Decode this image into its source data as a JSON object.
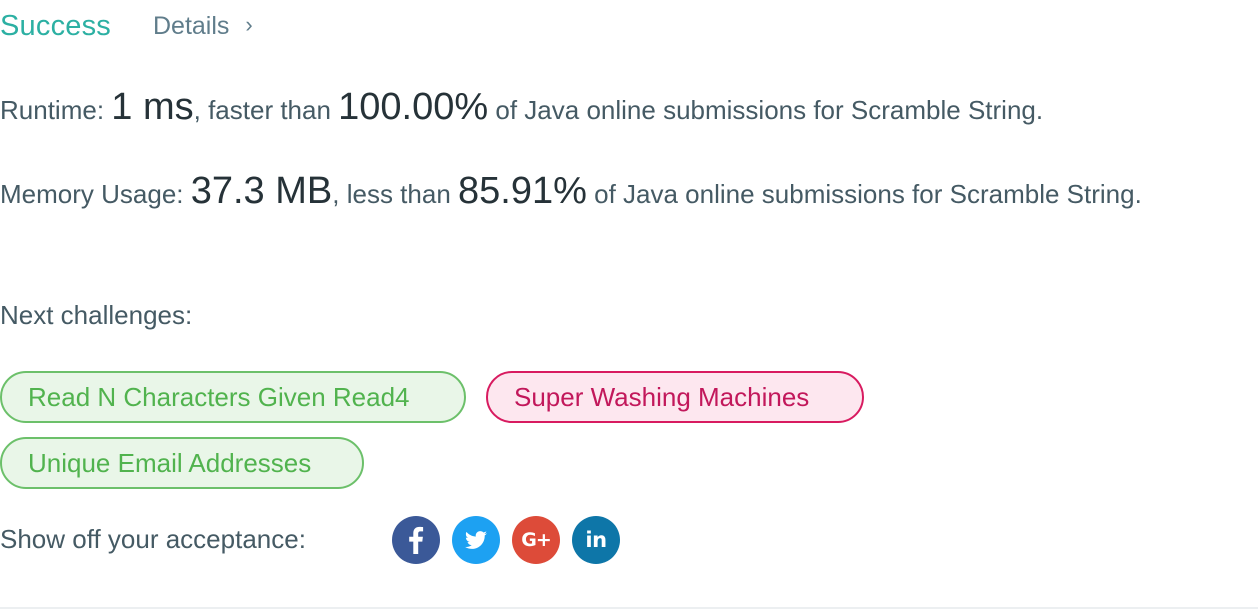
{
  "header": {
    "status": "Success",
    "details_label": "Details",
    "chevron": "›"
  },
  "runtime": {
    "label": "Runtime: ",
    "value": "1 ms",
    "comparator": ", faster than ",
    "percent": "100.00%",
    "suffix": " of Java online submissions for Scramble String."
  },
  "memory": {
    "label": "Memory Usage: ",
    "value": "37.3 MB",
    "comparator": ", less than ",
    "percent": "85.91%",
    "suffix": " of Java online submissions for Scramble String."
  },
  "next_challenges": {
    "label": "Next challenges:",
    "items": [
      {
        "title": "Read N Characters Given Read4",
        "difficulty": "easy"
      },
      {
        "title": "Super Washing Machines",
        "difficulty": "hard"
      },
      {
        "title": "Unique Email Addresses",
        "difficulty": "easy"
      }
    ]
  },
  "share": {
    "label": "Show off your acceptance:",
    "networks": [
      {
        "name": "facebook",
        "icon": "facebook-icon",
        "glyph": "f",
        "color": "#3b5998"
      },
      {
        "name": "twitter",
        "icon": "twitter-icon",
        "color": "#1da1f2"
      },
      {
        "name": "google-plus",
        "icon": "google-plus-icon",
        "glyph": "G+",
        "color": "#dd4b39"
      },
      {
        "name": "linkedin",
        "icon": "linkedin-icon",
        "glyph": "in",
        "color": "#0e76a8"
      }
    ]
  },
  "colors": {
    "success": "#2cb0a3",
    "easy_text": "#51b34e",
    "easy_bg": "#e9f6e8",
    "hard_text": "#c2185b",
    "hard_bg": "#fde7ef"
  }
}
